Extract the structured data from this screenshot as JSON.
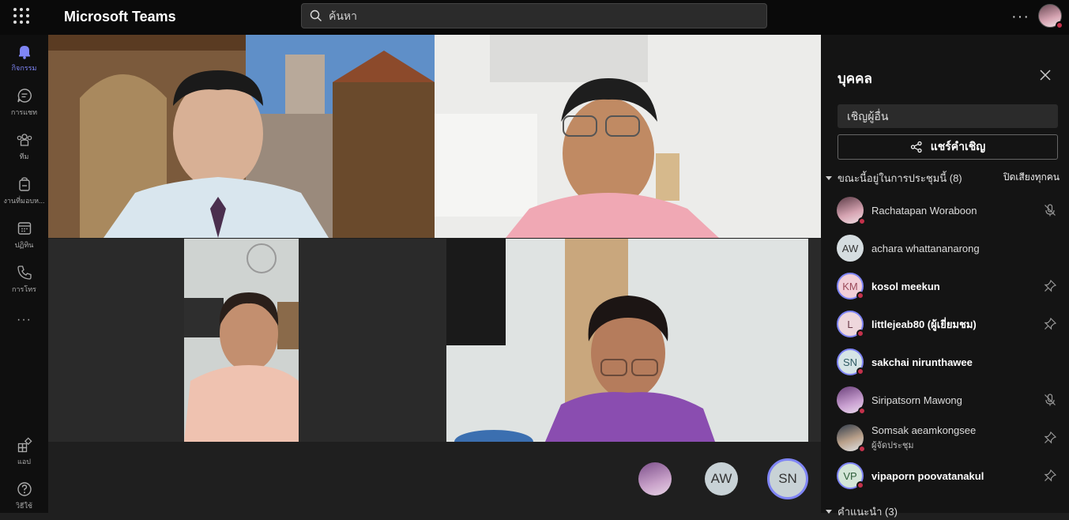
{
  "app": {
    "title": "Microsoft Teams"
  },
  "search": {
    "placeholder": "ค้นหา"
  },
  "rail": {
    "items": [
      {
        "label": "กิจกรรม",
        "icon": "bell-icon"
      },
      {
        "label": "การแชท",
        "icon": "chat-icon"
      },
      {
        "label": "ทีม",
        "icon": "teams-icon"
      },
      {
        "label": "งานที่มอบห...",
        "icon": "assignments-icon"
      },
      {
        "label": "ปฏิทิน",
        "icon": "calendar-icon"
      },
      {
        "label": "การโทร",
        "icon": "phone-icon"
      }
    ],
    "apps_label": "แอป",
    "help_label": "วิธีใช้"
  },
  "people_panel": {
    "title": "บุคคล",
    "invite_placeholder": "เชิญผู้อื่น",
    "share_label": "แชร์คำเชิญ",
    "in_meeting_label": "ขณะนี้อยู่ในการประชุมนี้ (8)",
    "mute_all_label": "ปิดเสียงทุกคน",
    "participants": [
      {
        "name": "Rachatapan Woraboon",
        "initials": "",
        "role": "",
        "icon": "mic-off-icon"
      },
      {
        "name": "achara whattananarong",
        "initials": "AW",
        "role": "",
        "icon": ""
      },
      {
        "name": "kosol meekun",
        "initials": "KM",
        "role": "",
        "icon": "pin-icon"
      },
      {
        "name": "littlejeab80 (ผู้เยี่ยมชม)",
        "initials": "L",
        "role": "",
        "icon": "pin-icon"
      },
      {
        "name": "sakchai nirunthawee",
        "initials": "SN",
        "role": "",
        "icon": ""
      },
      {
        "name": "Siripatsorn Mawong",
        "initials": "",
        "role": "",
        "icon": "mic-off-icon"
      },
      {
        "name": "Somsak aeamkongsee",
        "initials": "",
        "role": "ผู้จัดประชุม",
        "icon": "pin-icon"
      },
      {
        "name": "vipaporn poovatanakul",
        "initials": "VP",
        "role": "",
        "icon": "pin-icon"
      }
    ],
    "suggested_label": "คำแนะนำ (3)"
  },
  "dock": {
    "avatars": [
      {
        "initials": ""
      },
      {
        "initials": "AW"
      },
      {
        "initials": "SN"
      }
    ]
  },
  "colors": {
    "accent": "#7f85f5",
    "status_red": "#c4314b"
  }
}
